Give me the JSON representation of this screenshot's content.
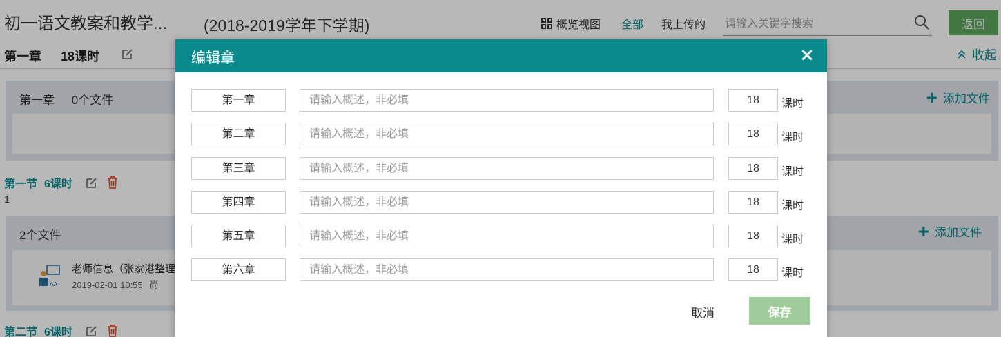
{
  "header": {
    "course_title": "初一语文教案和教学...",
    "term": "(2018-2019学年下学期)",
    "overview_label": "概览视图",
    "tab_all": "全部",
    "tab_mine": "我上传的",
    "search_placeholder": "请输入关键字搜索",
    "back_label": "返回"
  },
  "chapter": {
    "name": "第一章",
    "hours": "18课时",
    "collapse_label": "收起",
    "file_panel_name": "第一章",
    "file_panel_count": "0个文件",
    "add_file_label": "添加文件"
  },
  "section1": {
    "name": "第一节",
    "hours": "6课时",
    "description": "1",
    "file_count": "2个文件",
    "add_file_label": "添加文件",
    "file": {
      "name": "老师信息（张家港整理",
      "date": "2019-02-01 10:55",
      "status": "尚"
    }
  },
  "section2": {
    "name": "第二节",
    "hours": "6课时"
  },
  "modal": {
    "title": "编辑章",
    "description_placeholder": "请输入概述，非必填",
    "hours_unit": "课时",
    "rows": [
      {
        "chapter": "第一章",
        "hours": "18"
      },
      {
        "chapter": "第二章",
        "hours": "18"
      },
      {
        "chapter": "第三章",
        "hours": "18"
      },
      {
        "chapter": "第四章",
        "hours": "18"
      },
      {
        "chapter": "第五章",
        "hours": "18"
      },
      {
        "chapter": "第六章",
        "hours": "18"
      }
    ],
    "cancel_label": "取消",
    "save_label": "保存"
  },
  "colors": {
    "primary": "#0b8a8e",
    "back_button": "#5ba65a",
    "save_button": "#9fcc9a",
    "delete_icon": "#e0533a",
    "file_panel": "#dfe5ea"
  }
}
